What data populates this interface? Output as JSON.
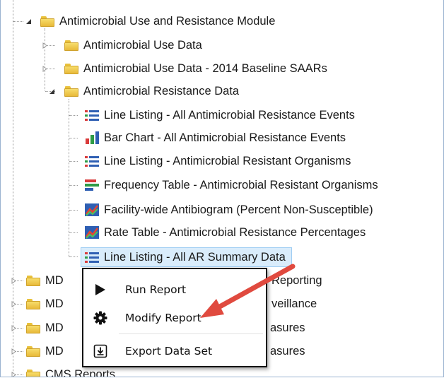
{
  "tree": {
    "root": "Antimicrobial Use and Resistance Module",
    "folder_use": "Antimicrobial Use Data",
    "folder_use_baseline": "Antimicrobial Use Data - 2014 Baseline SAARs",
    "folder_resistance": "Antimicrobial Resistance Data",
    "reports": [
      {
        "label": "Line Listing - All Antimicrobial Resistance Events",
        "icon": "line-listing-icon"
      },
      {
        "label": "Bar Chart - All Antimicrobial Resistance Events",
        "icon": "bar-chart-icon"
      },
      {
        "label": "Line Listing - Antimicrobial Resistant Organisms",
        "icon": "line-listing-icon"
      },
      {
        "label": "Frequency Table - Antimicrobial Resistant Organisms",
        "icon": "frequency-table-icon"
      },
      {
        "label": "Facility-wide Antibiogram (Percent Non-Susceptible)",
        "icon": "rate-chart-icon"
      },
      {
        "label": "Rate Table - Antimicrobial Resistance Percentages",
        "icon": "rate-chart-icon"
      },
      {
        "label": "Line Listing - All AR Summary Data",
        "icon": "line-listing-icon"
      }
    ],
    "other_folders": [
      {
        "prefix": "MD",
        "suffix": "Reporting"
      },
      {
        "prefix": "MD",
        "suffix": "veillance"
      },
      {
        "prefix": "MD",
        "suffix": "asures"
      },
      {
        "prefix": "MD",
        "suffix": "asures"
      }
    ],
    "cms_folder": "CMS Reports"
  },
  "context_menu": {
    "run_label": "Run Report",
    "modify_label": "Modify Report",
    "export_label": "Export Data Set"
  },
  "colors": {
    "selection": "#d9ecfb",
    "arrow": "#e04a3f"
  }
}
